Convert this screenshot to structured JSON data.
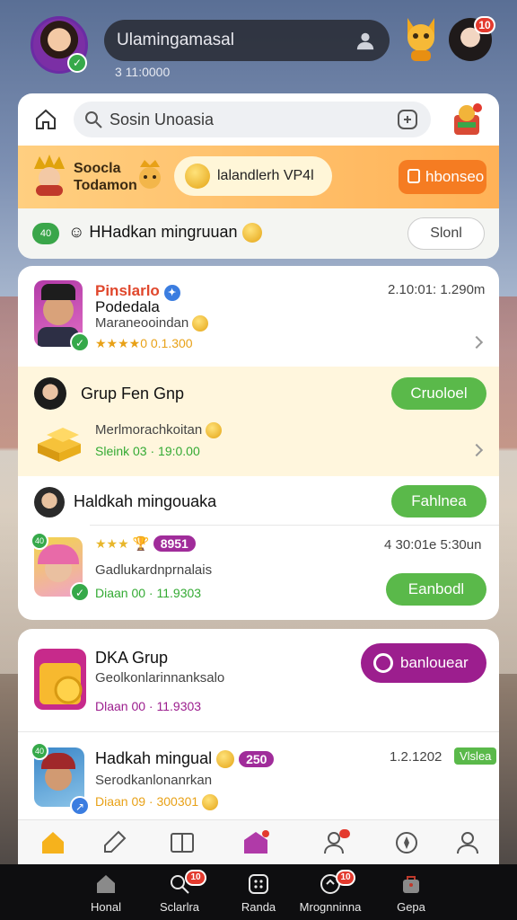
{
  "header": {
    "search_text": "Ulamingamasal",
    "sub_time": "3 11:0000",
    "profile_badge": "10"
  },
  "search": {
    "placeholder": "Sosin Unoasia"
  },
  "promo": {
    "title_line1": "Soocla",
    "title_line2": "Todamon",
    "pill_text": "lalandlerh VP4l",
    "button_label": "hbonseo"
  },
  "notice": {
    "chip": "40",
    "text": "HHadkan mingruuan",
    "button_label": "Slonl"
  },
  "feed": [
    {
      "name": "Pinslarlo",
      "sub": "Podedala",
      "desc": "Maraneooindan",
      "meta": "★★★★0 0.1.300",
      "time": "2.10:01: 1.290m"
    },
    {
      "name": "Grup Fen Gnp",
      "button_label": "Cruoloel",
      "desc": "Merlmorachkoitan",
      "meta": "Sleink 03 · 19:0.00"
    },
    {
      "name": "Haldkah mingouaka",
      "button_label": "Fahlnea",
      "badge": "8951",
      "desc": "Gadlukardnprnalais",
      "meta": "Diaan 00 · 11.9303",
      "time": "4 30:01e 5:30un",
      "button2_label": "Eanbodl",
      "chip": "40"
    },
    {
      "name": "DKA Grup",
      "desc": "Geolkonlarinnanksalo",
      "meta": "Dlaan 00 · 11.9303",
      "button_label": "banlouear"
    },
    {
      "name": "Hadkah mingual",
      "badge": "250",
      "desc": "Serodkanlonanrkan",
      "meta": "Diaan 09 · 300301",
      "time": "1.2.1202",
      "tag": "Vlslea",
      "chip": "40"
    }
  ],
  "bottom_nav": [
    {
      "label": "Honal",
      "icon": "home-icon"
    },
    {
      "label": "Sclarlra",
      "icon": "search-icon",
      "badge": "10"
    },
    {
      "label": "Randa",
      "icon": "grid-icon"
    },
    {
      "label": "Mrognninna",
      "icon": "chat-icon",
      "badge": "10"
    },
    {
      "label": "Gepa",
      "icon": "bag-icon"
    }
  ],
  "colors": {
    "accent_green": "#5ab94a",
    "accent_orange": "#f57c22",
    "accent_purple": "#9c1e8e",
    "badge_red": "#e33a2e"
  }
}
